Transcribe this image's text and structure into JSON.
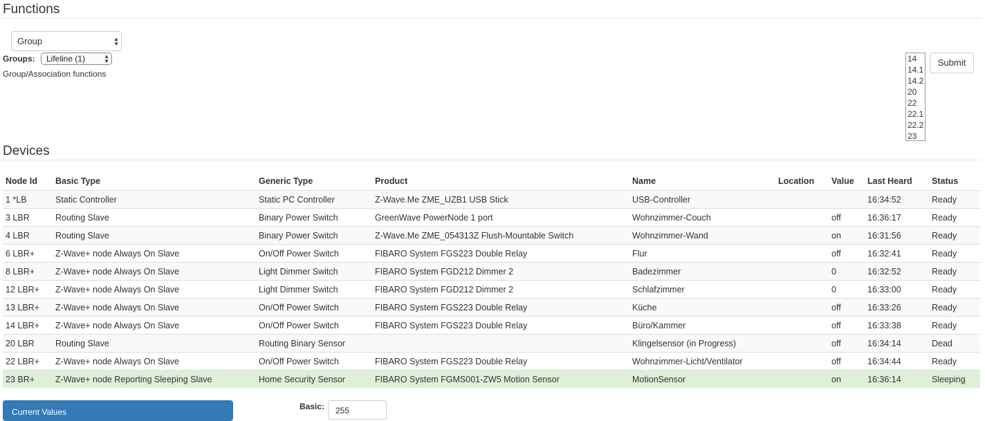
{
  "functions": {
    "title": "Functions",
    "function_select": "Group",
    "groups_label": "Groups:",
    "groups_select": "Lifeline (1)",
    "description": "Group/Association functions",
    "node_list": [
      "14",
      "14.1",
      "14.2",
      "20",
      "22",
      "22.1",
      "22.2",
      "23"
    ],
    "submit_label": "Submit"
  },
  "devices": {
    "title": "Devices",
    "columns": [
      "Node Id",
      "Basic Type",
      "Generic Type",
      "Product",
      "Name",
      "Location",
      "Value",
      "Last Heard",
      "Status"
    ],
    "rows": [
      {
        "node": "1 *LB",
        "basic": "Static Controller",
        "generic": "Static PC Controller",
        "product": "Z-Wave.Me ZME_UZB1 USB Stick",
        "name": "USB-Controller",
        "location": "",
        "value": "",
        "last": "16:34:52",
        "status": "Ready"
      },
      {
        "node": "3 LBR",
        "basic": "Routing Slave",
        "generic": "Binary Power Switch",
        "product": "GreenWave PowerNode 1 port",
        "name": "Wohnzimmer-Couch",
        "location": "",
        "value": "off",
        "last": "16:36:17",
        "status": "Ready"
      },
      {
        "node": "4 LBR",
        "basic": "Routing Slave",
        "generic": "Binary Power Switch",
        "product": "Z-Wave.Me ZME_054313Z Flush-Mountable Switch",
        "name": "Wohnzimmer-Wand",
        "location": "",
        "value": "on",
        "last": "16:31:56",
        "status": "Ready"
      },
      {
        "node": "6 LBR+",
        "basic": "Z-Wave+ node Always On Slave",
        "generic": "On/Off Power Switch",
        "product": "FIBARO System FGS223 Double Relay",
        "name": "Flur",
        "location": "",
        "value": "off",
        "last": "16:32:41",
        "status": "Ready"
      },
      {
        "node": "8 LBR+",
        "basic": "Z-Wave+ node Always On Slave",
        "generic": "Light Dimmer Switch",
        "product": "FIBARO System FGD212 Dimmer 2",
        "name": "Badezimmer",
        "location": "",
        "value": "0",
        "last": "16:32:52",
        "status": "Ready"
      },
      {
        "node": "12 LBR+",
        "basic": "Z-Wave+ node Always On Slave",
        "generic": "Light Dimmer Switch",
        "product": "FIBARO System FGD212 Dimmer 2",
        "name": "Schlafzimmer",
        "location": "",
        "value": "0",
        "last": "16:33:00",
        "status": "Ready"
      },
      {
        "node": "13 LBR+",
        "basic": "Z-Wave+ node Always On Slave",
        "generic": "On/Off Power Switch",
        "product": "FIBARO System FGS223 Double Relay",
        "name": "Küche",
        "location": "",
        "value": "off",
        "last": "16:33:26",
        "status": "Ready"
      },
      {
        "node": "14 LBR+",
        "basic": "Z-Wave+ node Always On Slave",
        "generic": "On/Off Power Switch",
        "product": "FIBARO System FGS223 Double Relay",
        "name": "Büro/Kammer",
        "location": "",
        "value": "off",
        "last": "16:33:38",
        "status": "Ready"
      },
      {
        "node": "20 LBR",
        "basic": "Routing Slave",
        "generic": "Routing Binary Sensor",
        "product": "",
        "name": "Klingelsensor (in Progress)",
        "location": "",
        "value": "off",
        "last": "16:34:14",
        "status": "Dead"
      },
      {
        "node": "22 LBR+",
        "basic": "Z-Wave+ node Always On Slave",
        "generic": "On/Off Power Switch",
        "product": "FIBARO System FGS223 Double Relay",
        "name": "Wohnzimmer-Licht/Ventilator",
        "location": "",
        "value": "off",
        "last": "16:34:44",
        "status": "Ready"
      },
      {
        "node": "23 BR+",
        "basic": "Z-Wave+ node Reporting Sleeping Slave",
        "generic": "Home Security Sensor",
        "product": "FIBARO System FGMS001-ZW5 Motion Sensor",
        "name": "MotionSensor",
        "location": "",
        "value": "on",
        "last": "16:36:14",
        "status": "Sleeping"
      }
    ],
    "selected_row": 10
  },
  "bottom": {
    "current_values_label": "Current Values",
    "basic_label": "Basic:",
    "basic_value": "255"
  },
  "colors": {
    "highlight_row": "#dff0d8",
    "striped_row": "#f9f9f9",
    "primary_button": "#337ab7"
  }
}
